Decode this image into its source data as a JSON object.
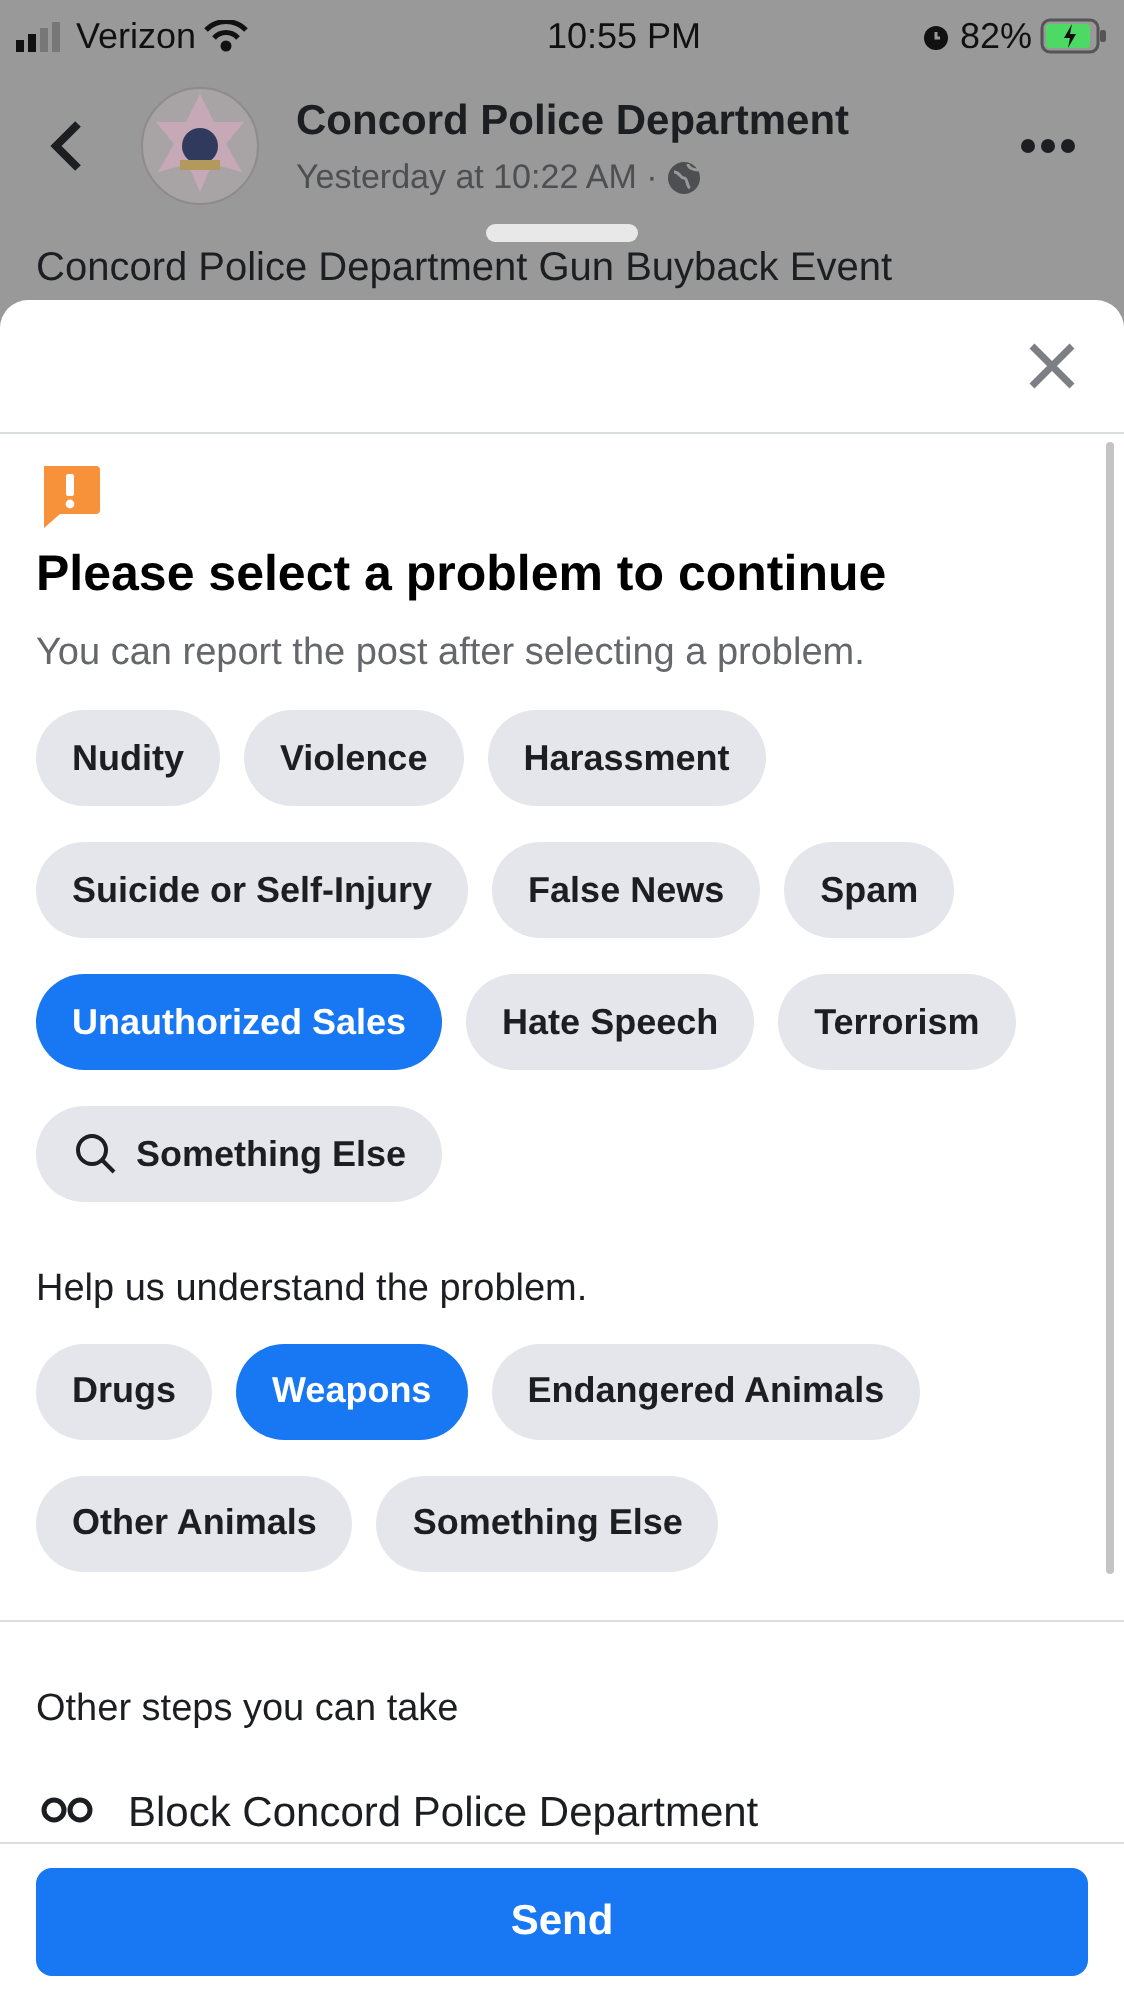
{
  "status_bar": {
    "carrier": "Verizon",
    "time": "10:55 PM",
    "battery": "82%"
  },
  "post": {
    "author": "Concord Police Department",
    "time": "Yesterday at 10:22 AM ·",
    "text": "Concord Police Department Gun Buyback Event"
  },
  "sheet": {
    "title": "Please select a problem to continue",
    "subtitle": "You can report the post after selecting a problem.",
    "problems": [
      {
        "label": "Nudity",
        "selected": false,
        "kind": "plain"
      },
      {
        "label": "Violence",
        "selected": false,
        "kind": "plain"
      },
      {
        "label": "Harassment",
        "selected": false,
        "kind": "plain"
      },
      {
        "label": "Suicide or Self-Injury",
        "selected": false,
        "kind": "plain"
      },
      {
        "label": "False News",
        "selected": false,
        "kind": "plain"
      },
      {
        "label": "Spam",
        "selected": false,
        "kind": "plain"
      },
      {
        "label": "Unauthorized Sales",
        "selected": true,
        "kind": "plain"
      },
      {
        "label": "Hate Speech",
        "selected": false,
        "kind": "plain"
      },
      {
        "label": "Terrorism",
        "selected": false,
        "kind": "plain"
      },
      {
        "label": "Something Else",
        "selected": false,
        "kind": "search"
      }
    ],
    "help_heading": "Help us understand the problem.",
    "details": [
      {
        "label": "Drugs",
        "selected": false,
        "kind": "plain"
      },
      {
        "label": "Weapons",
        "selected": true,
        "kind": "plain"
      },
      {
        "label": "Endangered Animals",
        "selected": false,
        "kind": "plain"
      },
      {
        "label": "Other Animals",
        "selected": false,
        "kind": "plain"
      },
      {
        "label": "Something Else",
        "selected": false,
        "kind": "plain"
      }
    ],
    "other_heading": "Other steps you can take",
    "other_steps": [
      "Block Concord Police Department"
    ],
    "send_button": "Send"
  }
}
